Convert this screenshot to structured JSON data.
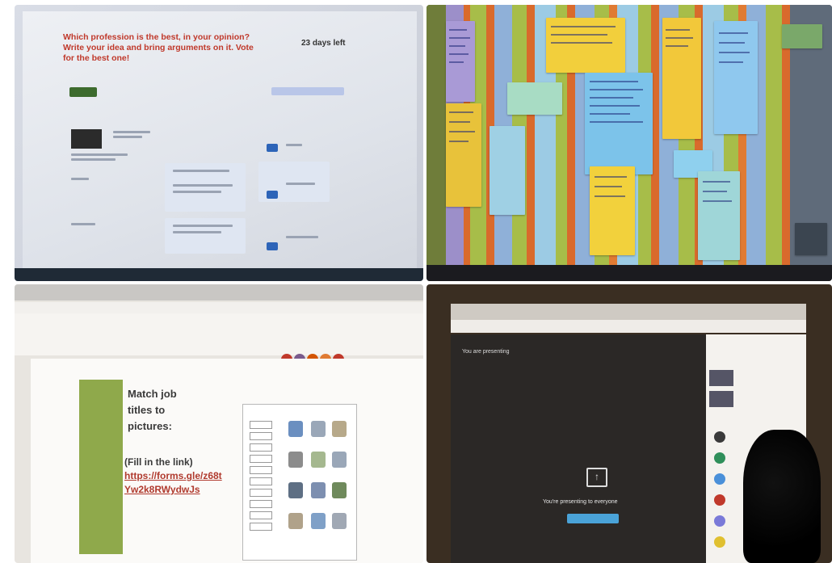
{
  "q1": {
    "prompt": "Which profession is the best, in your opinion? Write your idea and bring arguments on it. Vote for the best one!",
    "days": "23 days left"
  },
  "q3": {
    "heading_lines": [
      "Match job",
      "titles to",
      "pictures:"
    ],
    "fill_label": "(Fill in the link)",
    "link_lines": [
      "https://forms.gle/z68t",
      "Yw2k8RWydwJs"
    ]
  },
  "q4": {
    "presenting_header": "You are presenting",
    "presenting_message": "You're presenting to everyone"
  },
  "colors": {
    "prompt_red": "#c0392b",
    "doc_green": "#8fa94b",
    "link_red": "#b03a2e",
    "meet_blue": "#4aa3d8"
  }
}
